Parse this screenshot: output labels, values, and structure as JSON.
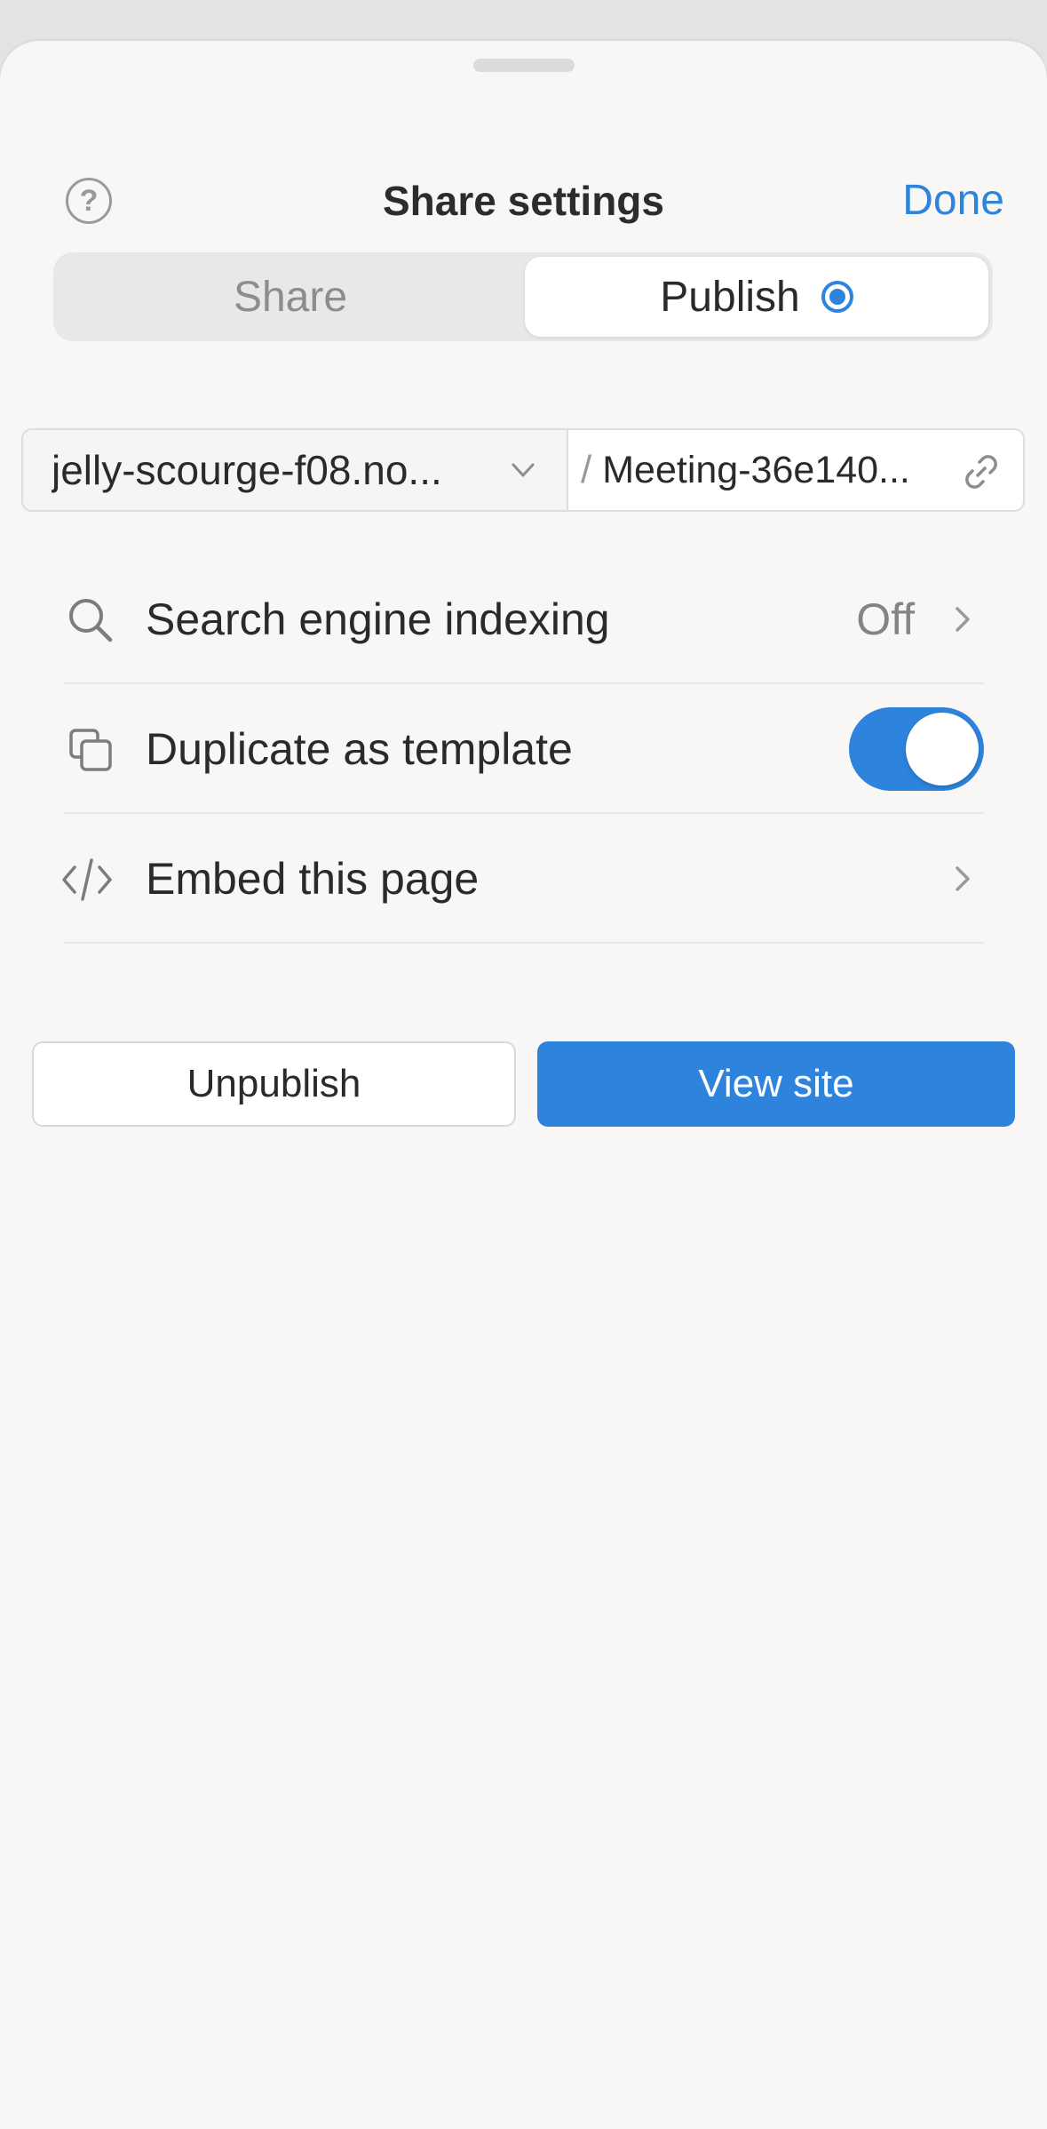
{
  "header": {
    "title": "Share settings",
    "done_label": "Done",
    "help_icon": "question-circle-icon"
  },
  "tabs": [
    {
      "label": "Share",
      "selected": false
    },
    {
      "label": "Publish",
      "selected": true,
      "status_icon": "radio-dot-icon"
    }
  ],
  "url": {
    "domain": "jelly-scourge-f08.no...",
    "separator": "/",
    "path": "Meeting-36e140..."
  },
  "settings": [
    {
      "icon": "search-icon",
      "label": "Search engine indexing",
      "value": "Off",
      "control": "chevron"
    },
    {
      "icon": "duplicate-icon",
      "label": "Duplicate as template",
      "control": "toggle",
      "enabled": true
    },
    {
      "icon": "code-icon",
      "label": "Embed this page",
      "control": "chevron"
    }
  ],
  "actions": {
    "unpublish_label": "Unpublish",
    "view_site_label": "View site"
  },
  "colors": {
    "accent": "#2e83dd",
    "background": "#f8f7f6"
  }
}
